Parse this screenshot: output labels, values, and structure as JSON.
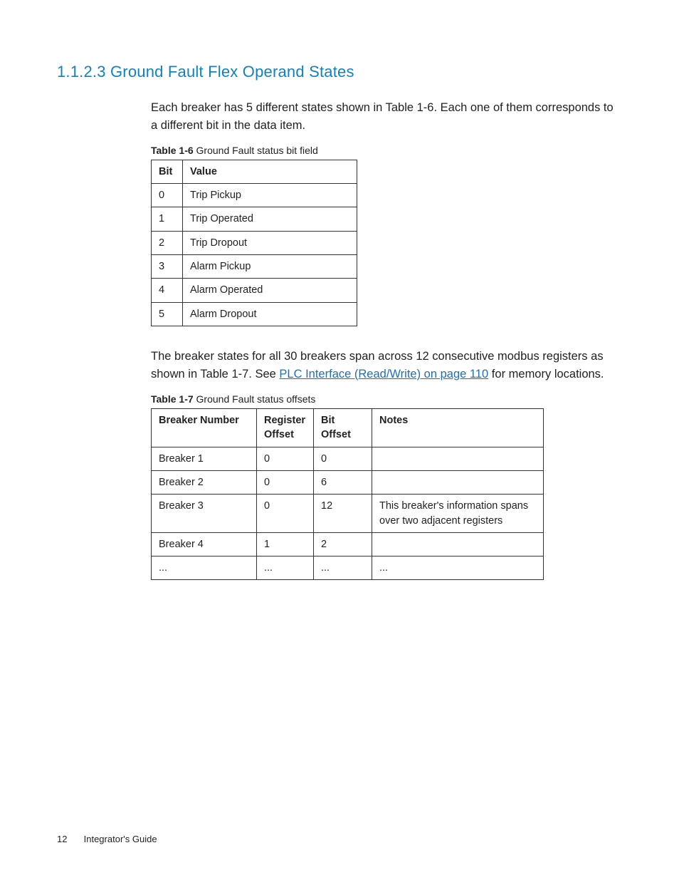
{
  "heading": "1.1.2.3 Ground Fault Flex Operand States",
  "para1": "Each breaker has 5 different states shown in Table 1-6. Each one of them corresponds to a different bit in the data item.",
  "table1": {
    "caption_bold": "Table 1-6",
    "caption_rest": "  Ground Fault status bit field",
    "head": {
      "bit": "Bit",
      "value": "Value"
    },
    "rows": [
      {
        "bit": "0",
        "value": "Trip Pickup"
      },
      {
        "bit": "1",
        "value": "Trip Operated"
      },
      {
        "bit": "2",
        "value": "Trip Dropout"
      },
      {
        "bit": "3",
        "value": "Alarm Pickup"
      },
      {
        "bit": "4",
        "value": "Alarm Operated"
      },
      {
        "bit": "5",
        "value": "Alarm Dropout"
      }
    ]
  },
  "para2_a": "The breaker states for all 30 breakers span across 12 consecutive modbus registers as shown in Table 1-7. See ",
  "para2_link": "PLC Interface (Read/Write) on page 110",
  "para2_b": " for memory locations.",
  "table2": {
    "caption_bold": "Table 1-7",
    "caption_rest": "  Ground Fault status offsets",
    "head": {
      "c1": "Breaker Number",
      "c2": "Register Offset",
      "c3": "Bit Offset",
      "c4": "Notes"
    },
    "rows": [
      {
        "c1": "Breaker 1",
        "c2": "0",
        "c3": "0",
        "c4": ""
      },
      {
        "c1": "Breaker 2",
        "c2": "0",
        "c3": "6",
        "c4": ""
      },
      {
        "c1": "Breaker 3",
        "c2": "0",
        "c3": "12",
        "c4": "This breaker's information spans over two adjacent registers"
      },
      {
        "c1": "Breaker 4",
        "c2": "1",
        "c3": "2",
        "c4": ""
      },
      {
        "c1": "...",
        "c2": "...",
        "c3": "...",
        "c4": "..."
      }
    ]
  },
  "footer": {
    "page": "12",
    "title": "Integrator's Guide"
  }
}
